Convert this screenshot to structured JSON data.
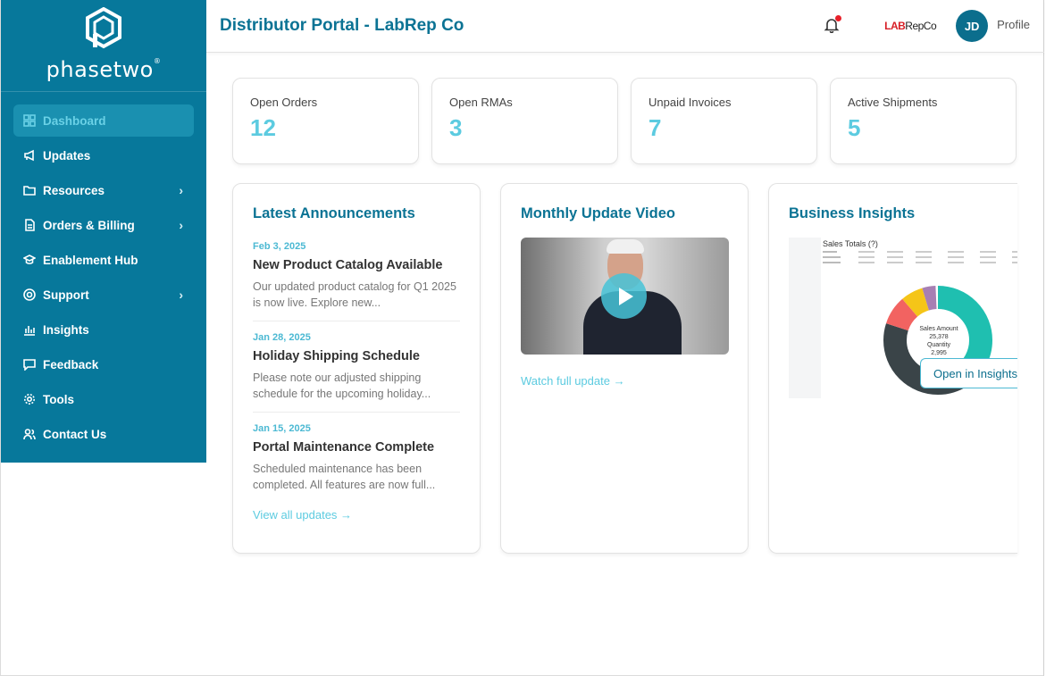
{
  "sidebar": {
    "brand": "phasetwo",
    "items": [
      {
        "label": "Dashboard",
        "icon": "grid-icon",
        "active": true,
        "chevron": false
      },
      {
        "label": "Updates",
        "icon": "megaphone-icon",
        "active": false,
        "chevron": false
      },
      {
        "label": "Resources",
        "icon": "folder-icon",
        "active": false,
        "chevron": true
      },
      {
        "label": "Orders & Billing",
        "icon": "document-icon",
        "active": false,
        "chevron": true
      },
      {
        "label": "Enablement Hub",
        "icon": "graduation-cap-icon",
        "active": false,
        "chevron": false
      },
      {
        "label": "Support",
        "icon": "lifebuoy-icon",
        "active": false,
        "chevron": true
      },
      {
        "label": "Insights",
        "icon": "bar-chart-icon",
        "active": false,
        "chevron": false
      },
      {
        "label": "Feedback",
        "icon": "chat-icon",
        "active": false,
        "chevron": false
      },
      {
        "label": "Tools",
        "icon": "gear-icon",
        "active": false,
        "chevron": false
      },
      {
        "label": "Contact Us",
        "icon": "users-icon",
        "active": false,
        "chevron": false
      }
    ]
  },
  "header": {
    "title": "Distributor Portal - LabRep Co",
    "brand_lab": "LAB",
    "brand_rep": "RepCo",
    "avatar_initials": "JD",
    "profile_label": "Profile"
  },
  "stats": [
    {
      "label": "Open Orders",
      "value": "12"
    },
    {
      "label": "Open RMAs",
      "value": "3"
    },
    {
      "label": "Unpaid Invoices",
      "value": "7"
    },
    {
      "label": "Active Shipments",
      "value": "5"
    }
  ],
  "announcements": {
    "title": "Latest Announcements",
    "items": [
      {
        "date": "Feb 3, 2025",
        "title": "New Product Catalog Available",
        "desc": "Our updated product catalog for Q1 2025 is now live. Explore new..."
      },
      {
        "date": "Jan 28, 2025",
        "title": "Holiday Shipping Schedule",
        "desc": "Please note our adjusted shipping schedule for the upcoming holiday..."
      },
      {
        "date": "Jan 15, 2025",
        "title": "Portal Maintenance Complete",
        "desc": "Scheduled maintenance has been completed. All features are now full..."
      }
    ],
    "link": "View all updates →"
  },
  "video": {
    "title": "Monthly Update Video",
    "link": "Watch full update →"
  },
  "insights": {
    "title": "Business Insights",
    "chart_title": "Sales Totals (?)",
    "center_label1": "Sales Amount",
    "center_value1": "25,378",
    "center_label2": "Quantity",
    "center_value2": "2,995",
    "open_button": "Open in Insights",
    "colors": {
      "teal": "#1fbfb0",
      "dark": "#3a4448",
      "red": "#f26361",
      "yellow": "#f5c518",
      "purple": "#a77fb3"
    }
  },
  "colors": {
    "sidebar": "#07789b",
    "accent": "#5ccbe0",
    "title": "#0b7394"
  }
}
